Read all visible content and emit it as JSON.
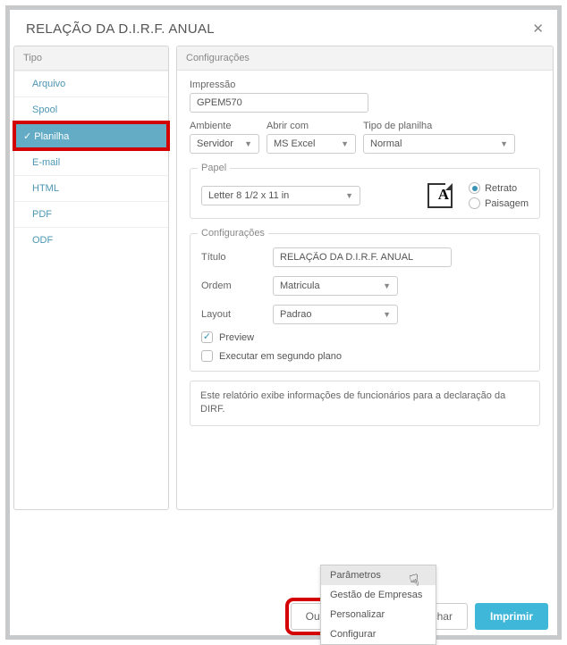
{
  "dialog": {
    "title": "RELAÇÃO DA D.I.R.F. ANUAL"
  },
  "leftPanel": {
    "header": "Tipo",
    "items": [
      "Arquivo",
      "Spool",
      "Planilha",
      "E-mail",
      "HTML",
      "PDF",
      "ODF"
    ],
    "selectedIndex": 2
  },
  "rightPanel": {
    "header": "Configurações",
    "impressao": {
      "label": "Impressão",
      "value": "GPEM570"
    },
    "ambiente": {
      "label": "Ambiente",
      "value": "Servidor"
    },
    "abrirCom": {
      "label": "Abrir com",
      "value": "MS Excel"
    },
    "tipoPlanilha": {
      "label": "Tipo de planilha",
      "value": "Normal"
    },
    "papel": {
      "legend": "Papel",
      "size": "Letter 8 1/2 x 11 in",
      "orient": {
        "retrato": "Retrato",
        "paisagem": "Paisagem",
        "selected": "retrato"
      }
    },
    "configs": {
      "legend": "Configurações",
      "titulo": {
        "label": "Título",
        "value": "RELAÇÃO DA D.I.R.F. ANUAL"
      },
      "ordem": {
        "label": "Ordem",
        "value": "Matricula"
      },
      "layout": {
        "label": "Layout",
        "value": "Padrao"
      },
      "preview": {
        "label": "Preview",
        "checked": true
      },
      "background": {
        "label": "Executar em segundo plano",
        "checked": false
      }
    },
    "descricao": "Este relatório exibe informações de funcionários para a declaração da DIRF."
  },
  "footer": {
    "outras": "Outras Ações",
    "fechar": "Fechar",
    "imprimir": "Imprimir"
  },
  "menu": {
    "items": [
      "Parâmetros",
      "Gestão de Empresas",
      "Personalizar",
      "Configurar"
    ],
    "hoverIndex": 0
  }
}
